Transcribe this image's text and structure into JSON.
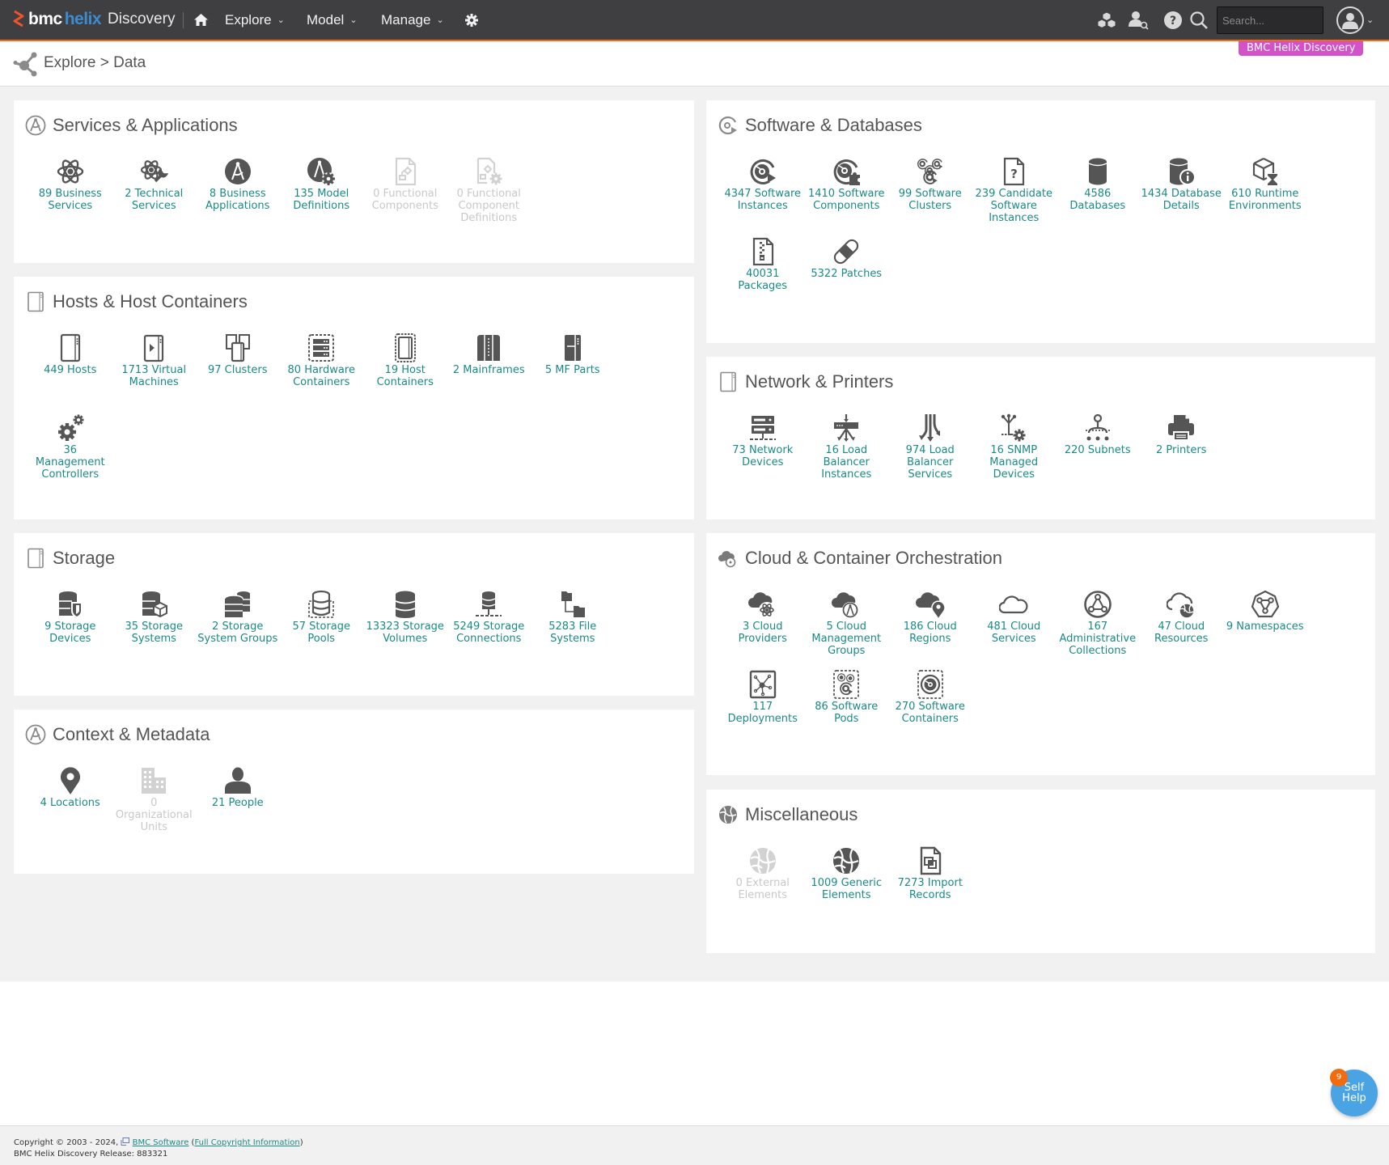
{
  "header": {
    "brand_bmc": "bmc",
    "brand_helix": "helix",
    "product": "Discovery",
    "nav": [
      {
        "label": "Explore",
        "icon": "chevron-down"
      },
      {
        "label": "Model",
        "icon": "chevron-down"
      },
      {
        "label": "Manage",
        "icon": "chevron-down"
      }
    ],
    "search_placeholder": "Search...",
    "icons": [
      "home-icon",
      "gear-icon",
      "cubes-icon",
      "user-search-icon",
      "help-icon",
      "search-icon",
      "avatar-icon"
    ],
    "accent_color": "#f26b0f",
    "bg_color": "#3f3f42"
  },
  "breadcrumb": {
    "parent": "Explore",
    "separator": ">",
    "current": "Data"
  },
  "badge": {
    "label": "BMC Helix Discovery",
    "color": "#d253c9"
  },
  "link_color": "#1a8a86",
  "panels": {
    "services": {
      "title": "Services & Applications",
      "items": [
        {
          "label": "89 Business Services",
          "icon": "atom",
          "enabled": true
        },
        {
          "label": "2 Technical Services",
          "icon": "atom-wrench",
          "enabled": true
        },
        {
          "label": "8 Business Applications",
          "icon": "compass-circle",
          "enabled": true
        },
        {
          "label": "135 Model Definitions",
          "icon": "compass-gear",
          "enabled": true
        },
        {
          "label": "0 Functional Components",
          "icon": "file-diagram",
          "enabled": false
        },
        {
          "label": "0 Functional Component Definitions",
          "icon": "file-diagram-gear",
          "enabled": false
        }
      ]
    },
    "hosts": {
      "title": "Hosts & Host Containers",
      "items": [
        {
          "label": "449 Hosts",
          "icon": "host",
          "enabled": true
        },
        {
          "label": "1713 Virtual Machines",
          "icon": "virtual-machine",
          "enabled": true
        },
        {
          "label": "97 Clusters",
          "icon": "cluster",
          "enabled": true
        },
        {
          "label": "80 Hardware Containers",
          "icon": "hardware-container",
          "enabled": true
        },
        {
          "label": "19 Host Containers",
          "icon": "host-container",
          "enabled": true
        },
        {
          "label": "2 Mainframes",
          "icon": "mainframe",
          "enabled": true
        },
        {
          "label": "5 MF Parts",
          "icon": "mf-part",
          "enabled": true
        },
        {
          "label": "36 Management Controllers",
          "icon": "gears",
          "enabled": true
        }
      ]
    },
    "storage": {
      "title": "Storage",
      "items": [
        {
          "label": "9 Storage Devices",
          "icon": "storage-shield",
          "enabled": true
        },
        {
          "label": "35 Storage Systems",
          "icon": "storage-cube",
          "enabled": true
        },
        {
          "label": "2 Storage System Groups",
          "icon": "storage-group",
          "enabled": true
        },
        {
          "label": "57 Storage Pools",
          "icon": "storage-pool",
          "enabled": true
        },
        {
          "label": "13323 Storage Volumes",
          "icon": "storage-volume",
          "enabled": true
        },
        {
          "label": "5249 Storage Connections",
          "icon": "storage-connection",
          "enabled": true
        },
        {
          "label": "5283 File Systems",
          "icon": "file-system",
          "enabled": true
        }
      ]
    },
    "context": {
      "title": "Context & Metadata",
      "items": [
        {
          "label": "4 Locations",
          "icon": "location-pin",
          "enabled": true
        },
        {
          "label": "0 Organizational Units",
          "icon": "building",
          "enabled": false
        },
        {
          "label": "21 People",
          "icon": "person",
          "enabled": true
        }
      ]
    },
    "software": {
      "title": "Software & Databases",
      "items": [
        {
          "label": "4347 Software Instances",
          "icon": "disc-play",
          "enabled": true
        },
        {
          "label": "1410 Software Components",
          "icon": "disc-puzzle",
          "enabled": true
        },
        {
          "label": "99 Software Clusters",
          "icon": "disc-cluster",
          "enabled": true
        },
        {
          "label": "239 Candidate Software Instances",
          "icon": "file-question",
          "enabled": true
        },
        {
          "label": "4586 Databases",
          "icon": "database",
          "enabled": true
        },
        {
          "label": "1434 Database Details",
          "icon": "database-info",
          "enabled": true
        },
        {
          "label": "610 Runtime Environments",
          "icon": "cube-hourglass",
          "enabled": true
        },
        {
          "label": "40031 Packages",
          "icon": "file-zip",
          "enabled": true
        },
        {
          "label": "5322 Patches",
          "icon": "bandage",
          "enabled": true
        }
      ]
    },
    "network": {
      "title": "Network & Printers",
      "items": [
        {
          "label": "73 Network Devices",
          "icon": "network-device",
          "enabled": true
        },
        {
          "label": "16 Load Balancer Instances",
          "icon": "load-balancer",
          "enabled": true
        },
        {
          "label": "974 Load Balancer Services",
          "icon": "load-balancer-service",
          "enabled": true
        },
        {
          "label": "16 SNMP Managed Devices",
          "icon": "snmp",
          "enabled": true
        },
        {
          "label": "220 Subnets",
          "icon": "subnet",
          "enabled": true
        },
        {
          "label": "2 Printers",
          "icon": "printer",
          "enabled": true
        }
      ]
    },
    "cloud": {
      "title": "Cloud & Container Orchestration",
      "items": [
        {
          "label": "3 Cloud Providers",
          "icon": "cloud-atom",
          "enabled": true
        },
        {
          "label": "5 Cloud Management Groups",
          "icon": "cloud-compass",
          "enabled": true
        },
        {
          "label": "186 Cloud Regions",
          "icon": "cloud-pin",
          "enabled": true
        },
        {
          "label": "481 Cloud Services",
          "icon": "cloud-outline",
          "enabled": true
        },
        {
          "label": "167 Administrative Collections",
          "icon": "admin-collection",
          "enabled": true
        },
        {
          "label": "47 Cloud Resources",
          "icon": "cloud-resource",
          "enabled": true
        },
        {
          "label": "9 Namespaces",
          "icon": "namespace",
          "enabled": true
        },
        {
          "label": "117 Deployments",
          "icon": "deployment",
          "enabled": true
        },
        {
          "label": "86 Software Pods",
          "icon": "software-pod",
          "enabled": true
        },
        {
          "label": "270 Software Containers",
          "icon": "software-container",
          "enabled": true
        }
      ]
    },
    "misc": {
      "title": "Miscellaneous",
      "items": [
        {
          "label": "0 External Elements",
          "icon": "globe-mesh",
          "enabled": false
        },
        {
          "label": "1009 Generic Elements",
          "icon": "globe-mesh",
          "enabled": true
        },
        {
          "label": "7273 Import Records",
          "icon": "file-import",
          "enabled": true
        }
      ]
    }
  },
  "footer": {
    "copyright": "Copyright © 2003 - 2024,",
    "company_link": "BMC Software",
    "copyright_link": "Full Copyright Information",
    "release": "BMC Helix Discovery Release: 883321"
  },
  "self_help": {
    "label_1": "Self",
    "label_2": "Help",
    "count": "9"
  }
}
